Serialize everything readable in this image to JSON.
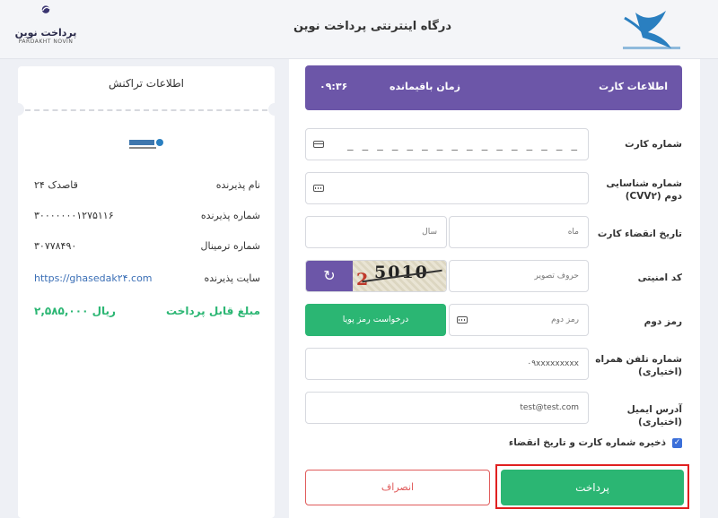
{
  "header": {
    "title": "درگاه اینترنتی پرداخت نوین",
    "brand_fa": "پرداخت نوین",
    "brand_en": "PARDAKHT NOVIN"
  },
  "transaction": {
    "title": "اطلاعات تراکنش",
    "rows": [
      {
        "label": "نام پذیرنده",
        "value": "قاصدک ۲۴"
      },
      {
        "label": "شماره پذیرنده",
        "value": "۳۰۰۰۰۰۰۰۱۲۷۵۱۱۶"
      },
      {
        "label": "شماره ترمینال",
        "value": "۳۰۷۷۸۴۹۰"
      },
      {
        "label": "سایت پذیرنده",
        "value": "https://ghasedak۲۴.com"
      }
    ],
    "amount_label": "مبلغ قابل پرداخت",
    "amount_value": "۲,۵۸۵,۰۰۰ ریال"
  },
  "card_form": {
    "title": "اطلاعات کارت",
    "timer_label": "زمان باقیمانده",
    "timer_value": "۰۹:۳۶",
    "card_number_label": "شماره کارت",
    "card_number_mask": "_ _ _ _    _ _ _ _    _ _ _ _    _ _ _ _",
    "cvv2_label": "شماره شناسایی دوم (CVV۲)",
    "expiry_label": "تاریخ انقضاء کارت",
    "month_placeholder": "ماه",
    "year_placeholder": "سال",
    "captcha_label": "کد امنیتی",
    "captcha_placeholder": "حروف تصویر",
    "captcha_first": "2",
    "captcha_rest": "5010",
    "refresh_symbol": "↻",
    "pin2_label": "رمز دوم",
    "pin2_placeholder": "رمز دوم",
    "dynamic_pin_button": "درخواست رمز پویا",
    "mobile_label": "شماره تلفن همراه (اختیاری)",
    "mobile_value": "۰۹xxxxxxxxx",
    "email_label": "آدرس ایمیل (اختیاری)",
    "email_value": "test@test.com",
    "save_card_label": "ذخیره شماره کارت و تاریخ انقضاء",
    "pay_button": "پرداخت",
    "cancel_button": "انصراف"
  },
  "colors": {
    "primary_purple": "#6c56a8",
    "success_green": "#2bb673",
    "danger_red": "#e05b5b",
    "link_blue": "#3b6fb6"
  }
}
